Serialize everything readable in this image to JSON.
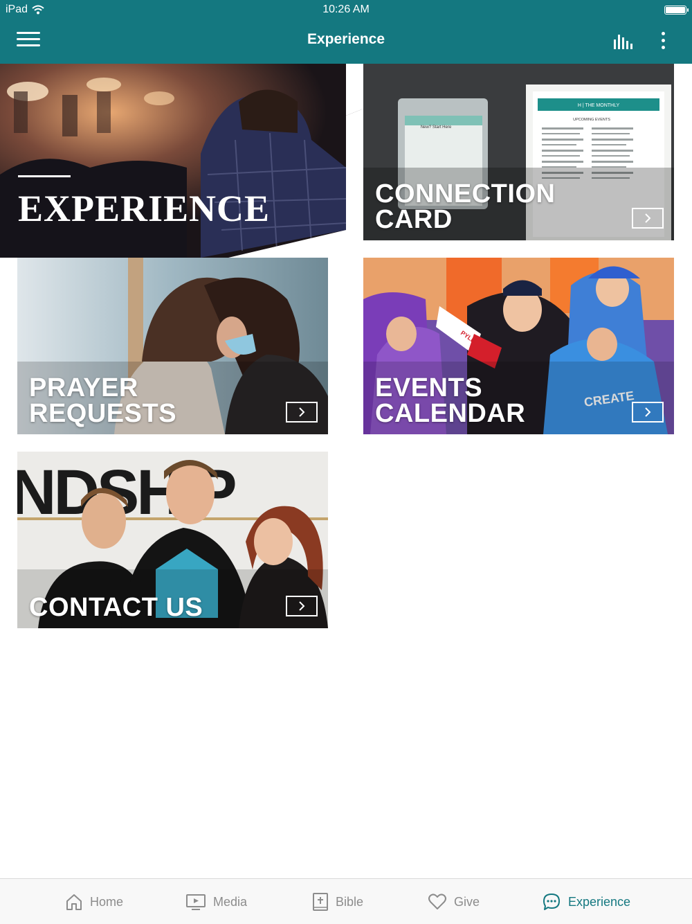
{
  "status_bar": {
    "device": "iPad",
    "time": "10:26 AM"
  },
  "header": {
    "title": "Experience"
  },
  "hero": {
    "title": "EXPERIENCE"
  },
  "tiles": [
    {
      "line1": "CONNECTION",
      "line2": "CARD"
    },
    {
      "line1": "PRAYER",
      "line2": "REQUESTS"
    },
    {
      "line1": "EVENTS",
      "line2": "CALENDAR"
    },
    {
      "line1": "CONTACT US",
      "line2": ""
    }
  ],
  "connection_card_photo": {
    "header": "H | THE MONTHLY",
    "subheader": "UPCOMING EVENTS",
    "left_card": "New? Start Here"
  },
  "contact_photo": {
    "wall_text": "NDSHIP"
  },
  "events_photo": {
    "megaphone_brand": "PYLE",
    "shirt_text": "CREATE"
  },
  "tabbar": {
    "items": [
      {
        "label": "Home",
        "icon": "home-icon"
      },
      {
        "label": "Media",
        "icon": "media-icon"
      },
      {
        "label": "Bible",
        "icon": "bible-icon"
      },
      {
        "label": "Give",
        "icon": "heart-icon"
      },
      {
        "label": "Experience",
        "icon": "chat-icon"
      }
    ],
    "active": "Experience"
  },
  "colors": {
    "brand": "#147880",
    "tab_inactive": "#8c8c8c",
    "tab_active": "#147880"
  }
}
